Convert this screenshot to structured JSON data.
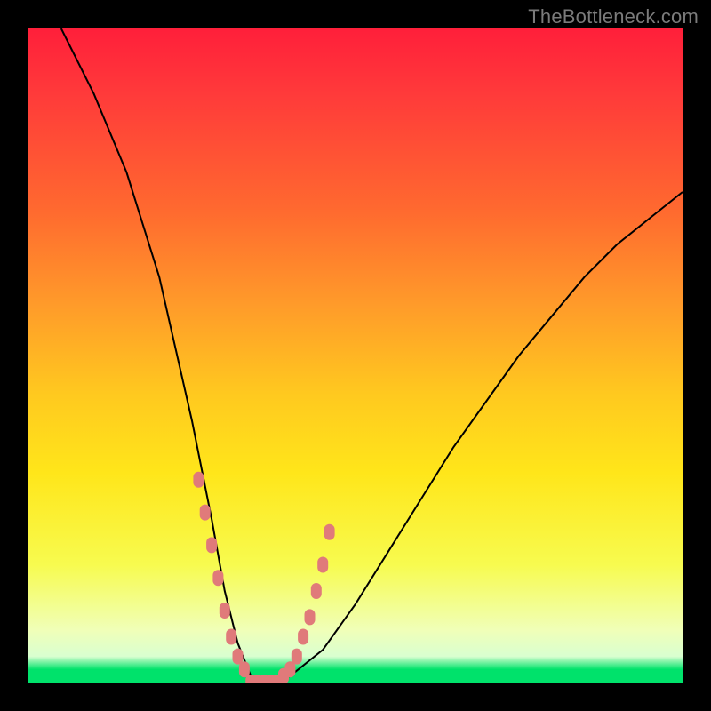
{
  "watermark": "TheBottleneck.com",
  "colors": {
    "frame": "#000000",
    "curve": "#000000",
    "markers": "#e07a7a",
    "green_band": "#00e26b"
  },
  "chart_data": {
    "type": "line",
    "title": "",
    "xlabel": "",
    "ylabel": "",
    "xlim": [
      0,
      100
    ],
    "ylim": [
      0,
      100
    ],
    "grid": false,
    "legend": false,
    "series": [
      {
        "name": "bottleneck-curve",
        "x": [
          5,
          10,
          15,
          20,
          25,
          28,
          30,
          32,
          34,
          36,
          38,
          40,
          45,
          50,
          55,
          60,
          65,
          70,
          75,
          80,
          85,
          90,
          95,
          100
        ],
        "y": [
          100,
          90,
          78,
          62,
          40,
          25,
          14,
          6,
          1,
          0,
          0,
          1,
          5,
          12,
          20,
          28,
          36,
          43,
          50,
          56,
          62,
          67,
          71,
          75
        ]
      }
    ],
    "markers": {
      "name": "highlighted-points",
      "x": [
        26,
        27,
        28,
        29,
        30,
        31,
        32,
        33,
        34,
        35,
        36,
        37,
        38,
        39,
        40,
        41,
        42,
        43,
        44,
        45,
        46
      ],
      "y": [
        31,
        26,
        21,
        16,
        11,
        7,
        4,
        2,
        0,
        0,
        0,
        0,
        0,
        1,
        2,
        4,
        7,
        10,
        14,
        18,
        23
      ]
    },
    "annotations": []
  }
}
